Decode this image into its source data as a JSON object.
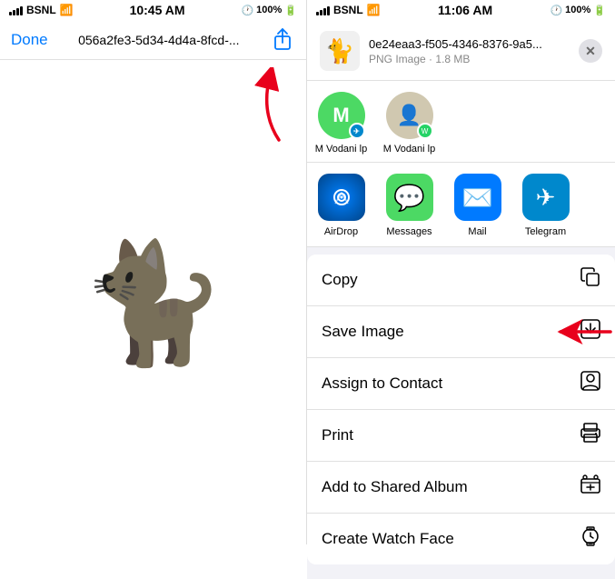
{
  "left": {
    "status": {
      "carrier": "BSNL",
      "time": "10:45 AM",
      "battery": "100%"
    },
    "nav": {
      "done_label": "Done",
      "file_title": "056a2fe3-5d34-4d4a-8fcd-..."
    }
  },
  "right": {
    "status": {
      "carrier": "BSNL",
      "time": "11:06 AM",
      "battery": "100%"
    },
    "file": {
      "name": "0e24eaa3-f505-4346-8376-9a5...",
      "type": "PNG Image",
      "size": "1.8 MB"
    },
    "contacts": [
      {
        "name": "M Vodani lp",
        "initial": "M",
        "type": "telegram"
      },
      {
        "name": "M Vodani lp",
        "initial": "",
        "type": "whatsapp"
      }
    ],
    "apps": [
      {
        "label": "AirDrop",
        "type": "airdrop"
      },
      {
        "label": "Messages",
        "type": "messages"
      },
      {
        "label": "Mail",
        "type": "mail"
      },
      {
        "label": "Telegram",
        "type": "telegram"
      }
    ],
    "actions": [
      {
        "label": "Copy",
        "icon": "📋"
      },
      {
        "label": "Save Image",
        "icon": "⬇"
      },
      {
        "label": "Assign to Contact",
        "icon": "👤"
      },
      {
        "label": "Print",
        "icon": "🖨"
      },
      {
        "label": "Add to Shared Album",
        "icon": "🗂"
      },
      {
        "label": "Create Watch Face",
        "icon": "⌚"
      }
    ]
  }
}
